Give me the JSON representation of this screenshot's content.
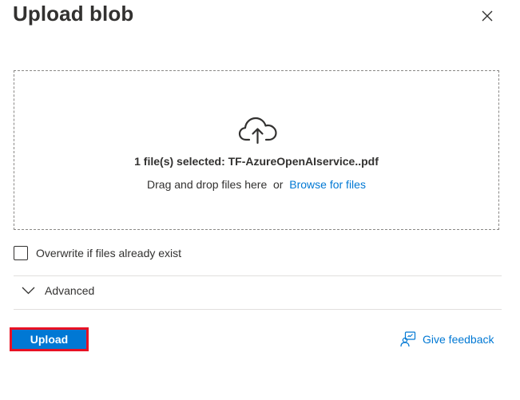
{
  "header": {
    "title": "Upload blob",
    "close_icon": "close-icon"
  },
  "dropzone": {
    "icon": "cloud-upload-icon",
    "selected_text": "1 file(s) selected: TF-AzureOpenAIservice..pdf",
    "drag_text": "Drag and drop files here",
    "or_text": "or",
    "browse_link": "Browse for files"
  },
  "options": {
    "overwrite_label": "Overwrite if files already exist",
    "overwrite_checked": false,
    "advanced_label": "Advanced",
    "advanced_icon": "chevron-down-icon"
  },
  "footer": {
    "upload_label": "Upload",
    "feedback_label": "Give feedback",
    "feedback_icon": "feedback-person-icon"
  },
  "colors": {
    "accent": "#0078d4",
    "highlight": "#e81123",
    "text": "#323130",
    "divider": "#e1dfdd"
  }
}
